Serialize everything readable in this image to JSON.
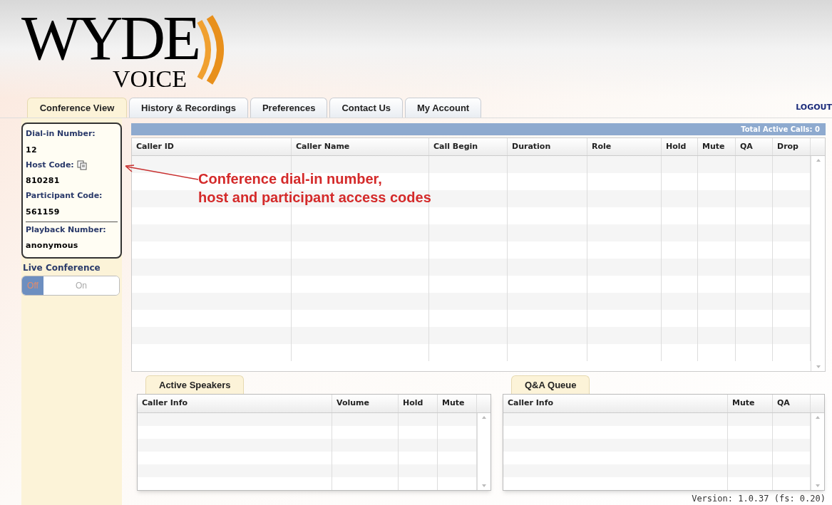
{
  "logo": {
    "name": "WYDE",
    "sub": "VOICE"
  },
  "tabs": [
    {
      "label": "Conference View",
      "selected": true
    },
    {
      "label": "History & Recordings",
      "selected": false
    },
    {
      "label": "Preferences",
      "selected": false
    },
    {
      "label": "Contact Us",
      "selected": false
    },
    {
      "label": "My Account",
      "selected": false
    }
  ],
  "logout": "LOGOUT",
  "sidebar": {
    "fields": [
      {
        "label": "Dial-in Number:",
        "value": "12",
        "copy": false
      },
      {
        "label": "Host Code:",
        "value": "810281",
        "copy": true
      },
      {
        "label": "Participant Code:",
        "value": "561159",
        "copy": false
      },
      {
        "label": "Playback Number:",
        "value": "anonymous",
        "copy": false
      }
    ],
    "live_conference": {
      "label": "Live Conference",
      "options": [
        {
          "label": "Off",
          "selected": true
        },
        {
          "label": "On",
          "selected": false
        }
      ]
    }
  },
  "calls_table": {
    "summary": "Total Active Calls: 0",
    "columns": [
      "Caller ID",
      "Caller Name",
      "Call Begin",
      "Duration",
      "Role",
      "Hold",
      "Mute",
      "QA",
      "Drop"
    ]
  },
  "active_speakers": {
    "tab": "Active Speakers",
    "columns": [
      "Caller Info",
      "Volume",
      "Hold",
      "Mute"
    ]
  },
  "qa_queue": {
    "tab": "Q&A Queue",
    "columns": [
      "Caller Info",
      "Mute",
      "QA"
    ]
  },
  "annotation": {
    "lines": [
      "Conference dial-in number,",
      "host and participant access codes"
    ]
  },
  "version": "Version: 1.0.37 (fs: 0.20)"
}
